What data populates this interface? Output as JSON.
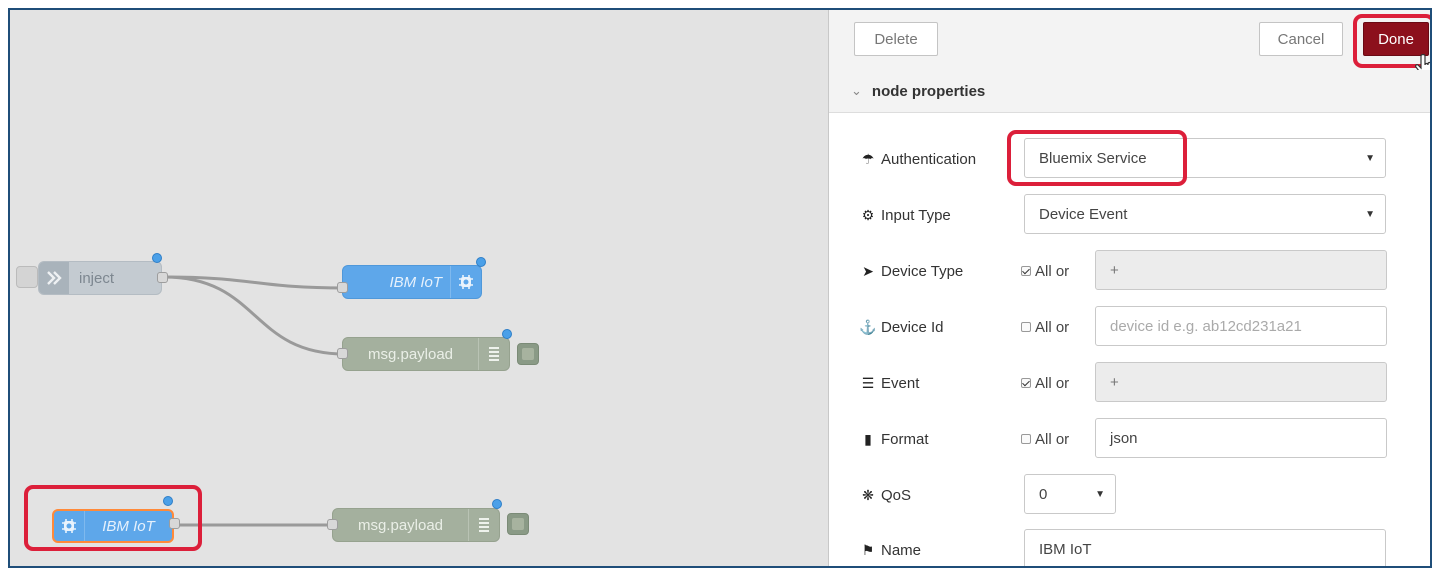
{
  "canvas": {
    "nodes": {
      "inject_label": "inject",
      "ibm_iot_top_label": "IBM IoT",
      "debug_top_label": "msg.payload",
      "ibm_iot_bottom_label": "IBM IoT",
      "debug_bottom_label": "msg.payload"
    }
  },
  "toolbar": {
    "delete_label": "Delete",
    "cancel_label": "Cancel",
    "done_label": "Done"
  },
  "section": {
    "title": "node properties"
  },
  "form": {
    "authentication": {
      "label": "Authentication",
      "icon": "umbrella-icon",
      "value": "Bluemix Service"
    },
    "input_type": {
      "label": "Input Type",
      "icon": "cogs-icon",
      "value": "Device Event"
    },
    "device_type": {
      "label": "Device Type",
      "icon": "rocket-icon",
      "all_label": "All or",
      "checked": true,
      "value": "+"
    },
    "device_id": {
      "label": "Device Id",
      "icon": "anchor-icon",
      "all_label": "All or",
      "checked": false,
      "placeholder": "device id e.g. ab12cd231a21"
    },
    "event": {
      "label": "Event",
      "icon": "tasks-icon",
      "all_label": "All or",
      "checked": true,
      "value": "+"
    },
    "format": {
      "label": "Format",
      "icon": "file-icon",
      "all_label": "All or",
      "checked": false,
      "value": "json"
    },
    "qos": {
      "label": "QoS",
      "icon": "asterisk-icon",
      "value": "0"
    },
    "name": {
      "label": "Name",
      "icon": "tag-icon",
      "value": "IBM IoT"
    }
  },
  "colors": {
    "accent": "#8c101c",
    "highlight": "#dc1f3a",
    "iot_node": "#5ea7ea",
    "debug_node": "#a4b09e",
    "inject_node": "#c4cbd1"
  }
}
